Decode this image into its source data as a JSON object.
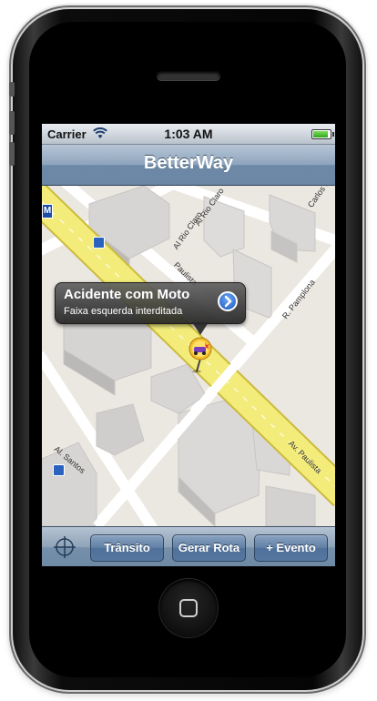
{
  "status_bar": {
    "carrier": "Carrier",
    "time": "1:03 AM",
    "battery_level": 0.9
  },
  "nav_bar": {
    "title": "BetterWay"
  },
  "map": {
    "street_labels": {
      "rio_claro_1": "Al Rio Claro",
      "rio_claro_2": "Al Rio Claro",
      "carlos": "Carlos do",
      "pamplona": "R. Pamplona",
      "paulista_1": "Paulista",
      "paulista_2": "Av. Paulista",
      "santos": "Al. Santos"
    },
    "metro_badge": "M",
    "pin_icon": "accident-pin-icon"
  },
  "callout": {
    "title": "Acidente com Moto",
    "subtitle": "Faixa esquerda interditada",
    "accessory_icon": "chevron-right-icon"
  },
  "toolbar": {
    "locate_icon": "crosshair-icon",
    "transit_label": "Trânsito",
    "route_label": "Gerar Rota",
    "event_label": "+ Evento"
  },
  "colors": {
    "nav_bar": "#7b95b1",
    "main_avenue": "#f3ec7a",
    "map_background": "#ebe7e1",
    "callout": "#3a3a3a"
  }
}
